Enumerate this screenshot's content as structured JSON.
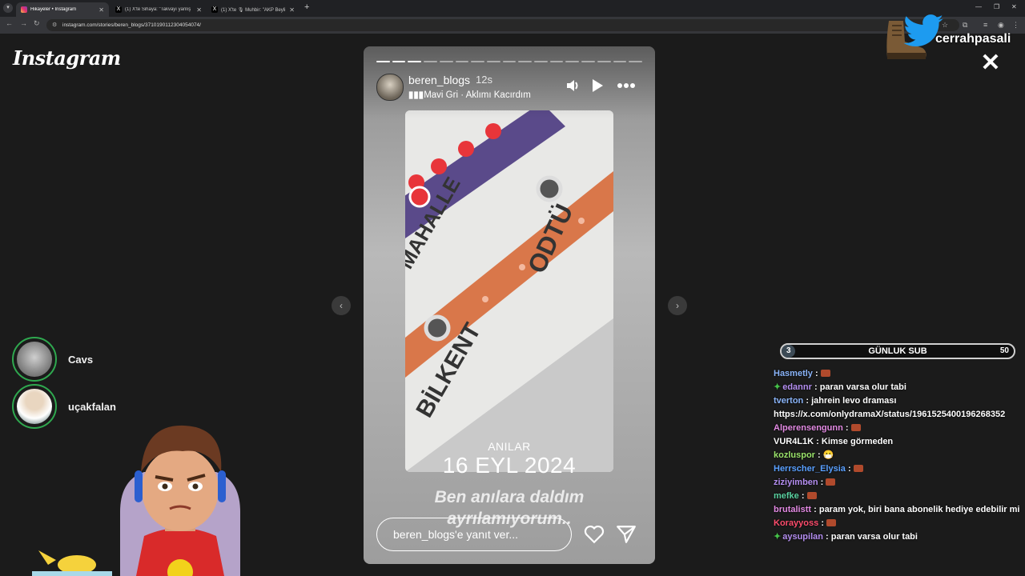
{
  "browser": {
    "tabs": [
      {
        "label": "Hikayeler • Instagram",
        "active": true
      },
      {
        "label": "(1) X'te Sihaya: \"Takvayı yanlış",
        "active": false
      },
      {
        "label": "(1) X'te 🎙 Muhbir: \"AKP Beyli...",
        "active": false
      }
    ],
    "url": "instagram.com/stories/beren_blogs/3710190112304054074/"
  },
  "instagram": {
    "logo": "Instagram",
    "close": "✕"
  },
  "twitter_overlay": {
    "handle": "cerrahpasali"
  },
  "story": {
    "username": "beren_blogs",
    "time": "12s",
    "music_artist": "Mavi Gri",
    "music_separator": "·",
    "music_title": "Aklımı Kacırdım",
    "progress_total": 17,
    "progress_done": 3,
    "sign_texts": [
      "MAHALLE",
      "ODTÜ",
      "BİLKENT"
    ],
    "caption_small": "ANILAR",
    "caption_date": "16 EYL 2024",
    "quote": "Ben anılara daldım ayrılamıyorum..",
    "reply_placeholder": "beren_blogs'e yanıt ver..."
  },
  "side_stories": [
    {
      "name": "Cavs"
    },
    {
      "name": "uçakfalan"
    }
  ],
  "sub_goal": {
    "current": "3",
    "label": "GÜNLUK SUB",
    "target": "50",
    "progress": 0.06
  },
  "chat": [
    {
      "user": "Hasmetly",
      "color": "#8ab4f8",
      "text": "",
      "emote": true,
      "badge": false
    },
    {
      "user": "edannr",
      "color": "#b48ef0",
      "text": "paran varsa olur tabi",
      "emote": false,
      "badge": true
    },
    {
      "user": "tverton",
      "color": "#8ab4f8",
      "text": "jahrein levo draması https://x.com/onlydramaX/status/1961525400196268352",
      "emote": false,
      "badge": false,
      "wrap": true
    },
    {
      "user": "Alperensengunn",
      "color": "#e38ae3",
      "text": "",
      "emote": true,
      "badge": false
    },
    {
      "user": "VUR4L1K",
      "color": "#ffffff",
      "text": "Kimse görmeden",
      "emote": false,
      "badge": false
    },
    {
      "user": "kozluspor",
      "color": "#9be36b",
      "text": "😷",
      "emote": false,
      "badge": false
    },
    {
      "user": "Herrscher_Elysia",
      "color": "#5aa0ff",
      "text": "",
      "emote": true,
      "badge": false
    },
    {
      "user": "ziziyimben",
      "color": "#b48ef0",
      "text": "",
      "emote": true,
      "badge": false
    },
    {
      "user": "mefke",
      "color": "#5ad1a0",
      "text": "",
      "emote": true,
      "badge": false
    },
    {
      "user": "brutalistt",
      "color": "#e38ae3",
      "text": "param yok, biri bana abonelik hediye edebilir mi",
      "emote": false,
      "badge": false
    },
    {
      "user": "Korayyoss",
      "color": "#ff4d6d",
      "text": "",
      "emote": true,
      "badge": false
    },
    {
      "user": "aysupilan",
      "color": "#b48ef0",
      "text": "paran varsa olur tabi",
      "emote": false,
      "badge": true
    }
  ]
}
